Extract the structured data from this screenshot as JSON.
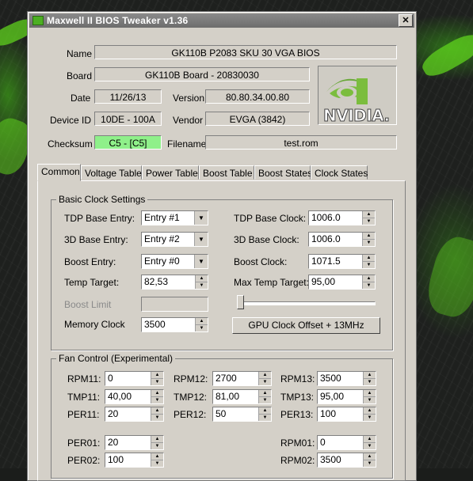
{
  "window": {
    "title": "Maxwell II BIOS Tweaker v1.36",
    "close_glyph": "✕"
  },
  "info": {
    "name_label": "Name",
    "name_value": "GK110B P2083 SKU 30 VGA BIOS",
    "board_label": "Board",
    "board_value": "GK110B Board - 20830030",
    "date_label": "Date",
    "date_value": "11/26/13",
    "version_label": "Version",
    "version_value": "80.80.34.00.80",
    "device_label": "Device ID",
    "device_value": "10DE - 100A",
    "vendor_label": "Vendor",
    "vendor_value": "EVGA (3842)",
    "checksum_label": "Checksum",
    "checksum_value": "C5 - [C5]",
    "filename_label": "Filename",
    "filename_value": "test.rom",
    "logo_text": "NVIDIA."
  },
  "tabs": [
    "Common",
    "Voltage Table",
    "Power Table",
    "Boost Table",
    "Boost States",
    "Clock States"
  ],
  "basic": {
    "title": "Basic Clock Settings",
    "tdp_entry_label": "TDP Base Entry:",
    "tdp_entry_value": "Entry #1",
    "d3_entry_label": "3D Base Entry:",
    "d3_entry_value": "Entry #2",
    "boost_entry_label": "Boost Entry:",
    "boost_entry_value": "Entry #0",
    "temp_target_label": "Temp Target:",
    "temp_target_value": "82,53",
    "boost_limit_label": "Boost Limit",
    "memory_clock_label": "Memory Clock",
    "memory_clock_value": "3500",
    "tdp_clock_label": "TDP Base Clock:",
    "tdp_clock_value": "1006.0",
    "d3_clock_label": "3D Base Clock:",
    "d3_clock_value": "1006.0",
    "boost_clock_label": "Boost Clock:",
    "boost_clock_value": "1071.5",
    "max_temp_label": "Max Temp Target:",
    "max_temp_value": "95,00",
    "slider_level": 0.0,
    "offset_button": "GPU Clock Offset + 13MHz"
  },
  "fan": {
    "title": "Fan Control (Experimental)",
    "rpm11_label": "RPM11:",
    "rpm11": "0",
    "tmp11_label": "TMP11:",
    "tmp11": "40,00",
    "per11_label": "PER11:",
    "per11": "20",
    "rpm12_label": "RPM12:",
    "rpm12": "2700",
    "tmp12_label": "TMP12:",
    "tmp12": "81,00",
    "per12_label": "PER12:",
    "per12": "50",
    "rpm13_label": "RPM13:",
    "rpm13": "3500",
    "tmp13_label": "TMP13:",
    "tmp13": "95,00",
    "per13_label": "PER13:",
    "per13": "100",
    "per01_label": "PER01:",
    "per01": "20",
    "per02_label": "PER02:",
    "per02": "100",
    "rpm01_label": "RPM01:",
    "rpm01": "0",
    "rpm02_label": "RPM02:",
    "rpm02": "3500"
  }
}
